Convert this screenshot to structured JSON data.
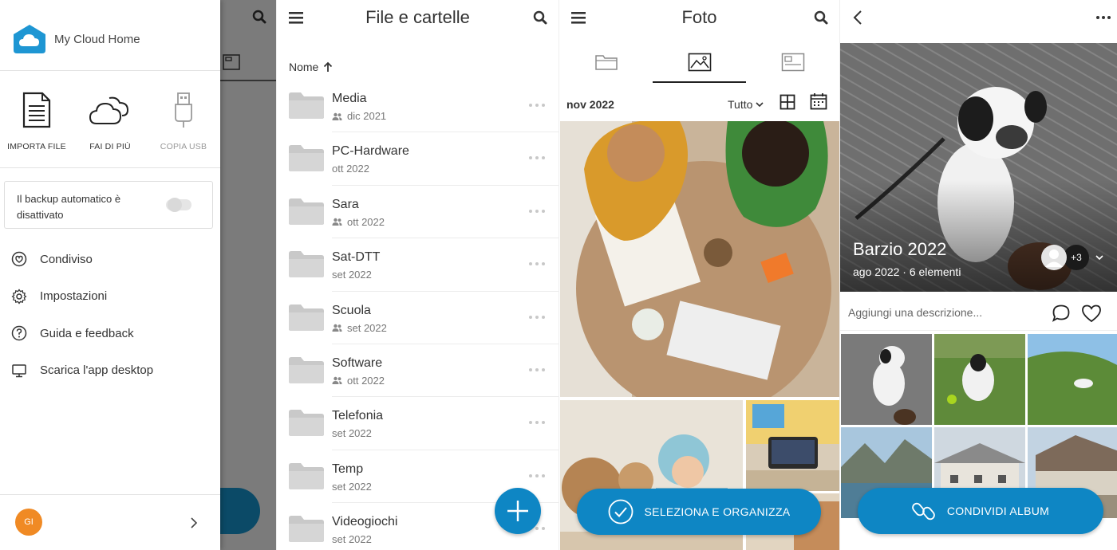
{
  "drawer": {
    "brand_name": "My Cloud Home",
    "actions": [
      {
        "label": "IMPORTA FILE",
        "icon": "document-icon"
      },
      {
        "label": "FAI DI PIÙ",
        "icon": "cloud-icon"
      },
      {
        "label": "COPIA USB",
        "icon": "usb-icon",
        "disabled": true
      }
    ],
    "backup_text": "Il backup automatico è disattivato",
    "backup_enabled": false,
    "menu": [
      {
        "label": "Condiviso",
        "icon": "shared-icon"
      },
      {
        "label": "Impostazioni",
        "icon": "settings-icon"
      },
      {
        "label": "Guida e feedback",
        "icon": "help-icon"
      },
      {
        "label": "Scarica l'app desktop",
        "icon": "monitor-icon"
      }
    ],
    "avatar_initials": "GI"
  },
  "files": {
    "title": "File e cartelle",
    "sort_label": "Nome",
    "folders": [
      {
        "name": "Media",
        "date": "dic 2021",
        "shared": true
      },
      {
        "name": "PC-Hardware",
        "date": "ott 2022",
        "shared": false
      },
      {
        "name": "Sara",
        "date": "ott 2022",
        "shared": true
      },
      {
        "name": "Sat-DTT",
        "date": "set 2022",
        "shared": false
      },
      {
        "name": "Scuola",
        "date": "set 2022",
        "shared": true
      },
      {
        "name": "Software",
        "date": "ott 2022",
        "shared": true
      },
      {
        "name": "Telefonia",
        "date": "set 2022",
        "shared": false
      },
      {
        "name": "Temp",
        "date": "set 2022",
        "shared": false
      },
      {
        "name": "Videogiochi",
        "date": "set 2022",
        "shared": false
      }
    ]
  },
  "photos": {
    "title": "Foto",
    "date_header": "nov 2022",
    "filter_label": "Tutto",
    "select_button": "SELEZIONA E ORGANIZZA"
  },
  "album": {
    "title": "Barzio 2022",
    "meta": "ago 2022 · 6 elementi",
    "extra_members": "+3",
    "description_placeholder": "Aggiungi una descrizione...",
    "share_button": "CONDIVIDI ALBUM"
  },
  "colors": {
    "accent": "#0e86c4",
    "logo": "#1e96d3",
    "avatar": "#f08a24"
  }
}
